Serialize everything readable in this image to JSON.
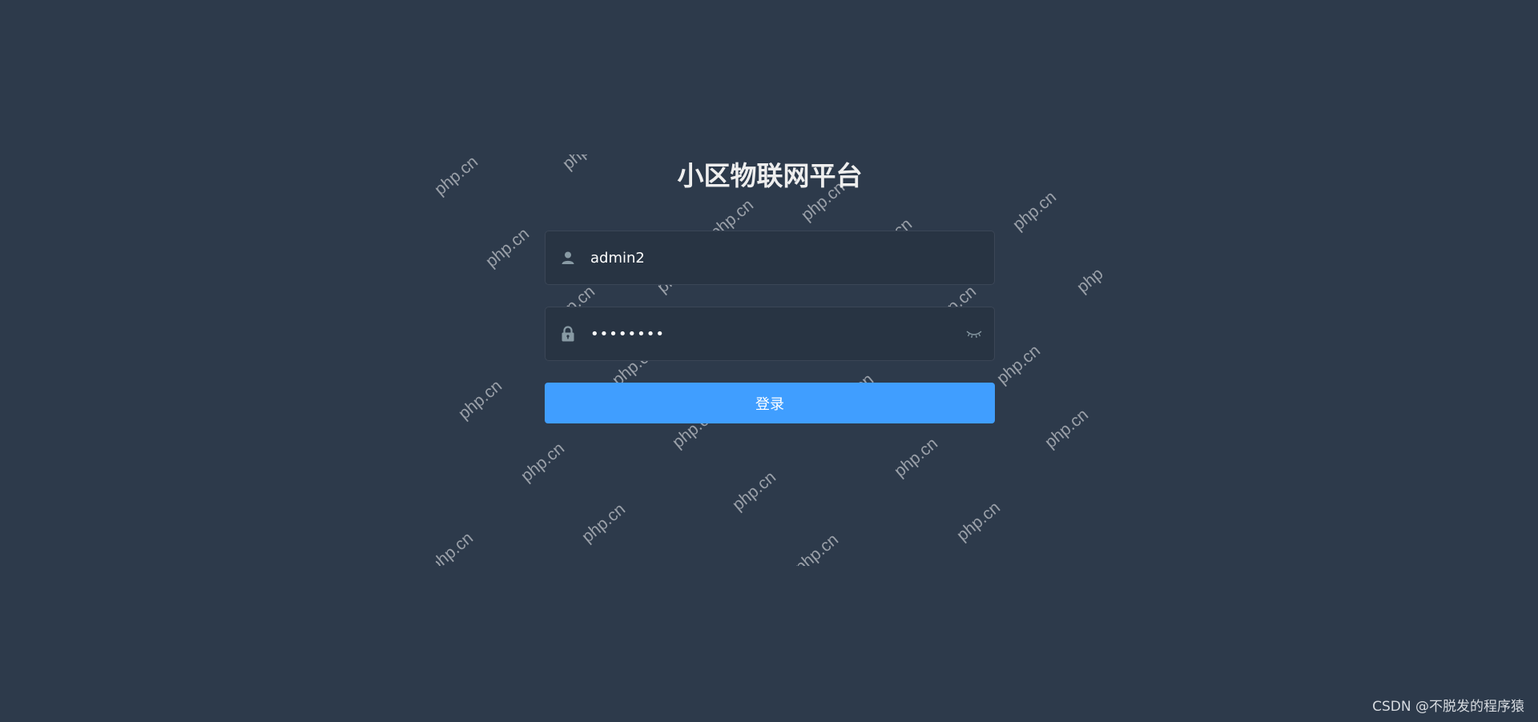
{
  "login": {
    "title": "小区物联网平台",
    "username": {
      "value": "admin2",
      "icon": "user-icon"
    },
    "password": {
      "value": "••••••••",
      "icon": "lock-icon",
      "toggle_icon": "eye-closed-icon"
    },
    "submit_label": "登录"
  },
  "watermark": {
    "text": "php.cn"
  },
  "footer": {
    "credit": "CSDN @不脱发的程序猿"
  },
  "colors": {
    "background": "#2d3a4b",
    "input_bg": "#283443",
    "primary": "#409eff"
  }
}
